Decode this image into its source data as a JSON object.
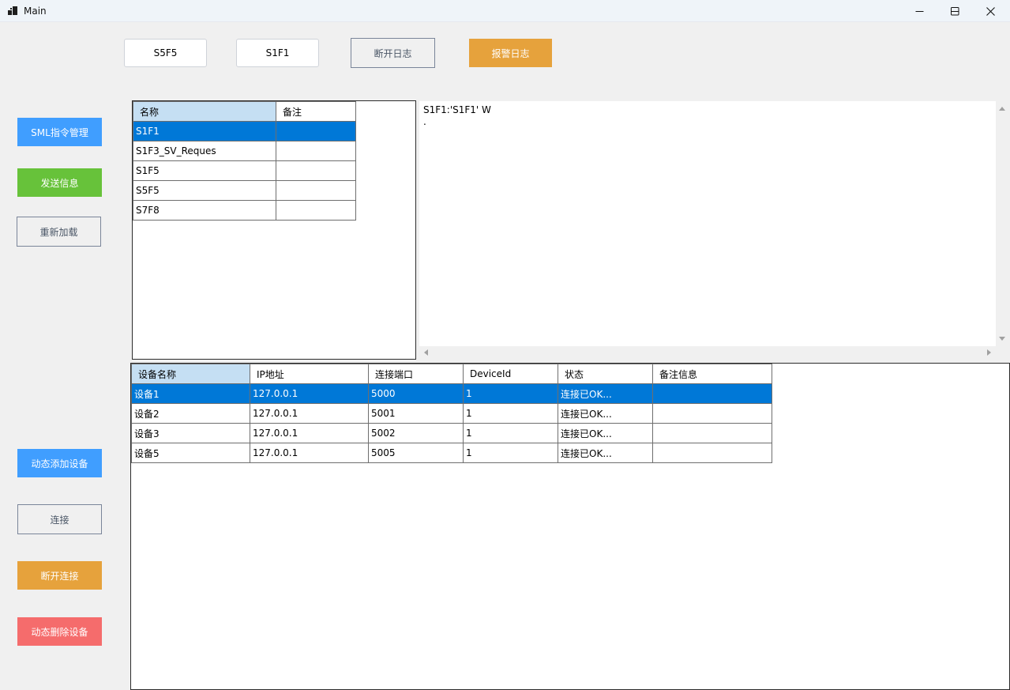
{
  "window": {
    "title": "Main",
    "controls": {
      "minimize_icon": "minimize-icon",
      "maximize_icon": "maximize-icon",
      "close_icon": "close-icon"
    }
  },
  "top_toolbar": {
    "s5f5_label": "S5F5",
    "s1f1_label": "S1F1",
    "disconnect_log_label": "断开日志",
    "alarm_log_label": "报警日志"
  },
  "left_panel": {
    "sml_manage_label": "SML指令管理",
    "send_message_label": "发送信息",
    "reload_label": "重新加载",
    "add_device_label": "动态添加设备",
    "connect_label": "连接",
    "disconnect_label": "断开连接",
    "delete_device_label": "动态删除设备"
  },
  "command_table": {
    "columns": [
      "名称",
      "备注"
    ],
    "rows": [
      {
        "name": "S1F1",
        "note": "",
        "selected": true
      },
      {
        "name": "S1F3_SV_Reques",
        "note": "",
        "selected": false
      },
      {
        "name": "S1F5",
        "note": "",
        "selected": false
      },
      {
        "name": "S5F5",
        "note": "",
        "selected": false
      },
      {
        "name": "S7F8",
        "note": "",
        "selected": false
      }
    ]
  },
  "message_log": {
    "lines": [
      "S1F1:'S1F1' W",
      "."
    ]
  },
  "device_table": {
    "columns": [
      "设备名称",
      "IP地址",
      "连接端口",
      "DeviceId",
      "状态",
      "备注信息"
    ],
    "rows": [
      {
        "name": "设备1",
        "ip": "127.0.0.1",
        "port": "5000",
        "device_id": "1",
        "status": "连接已OK...",
        "note": "",
        "selected": true
      },
      {
        "name": "设备2",
        "ip": "127.0.0.1",
        "port": "5001",
        "device_id": "1",
        "status": "连接已OK...",
        "note": "",
        "selected": false
      },
      {
        "name": "设备3",
        "ip": "127.0.0.1",
        "port": "5002",
        "device_id": "1",
        "status": "连接已OK...",
        "note": "",
        "selected": false
      },
      {
        "name": "设备5",
        "ip": "127.0.0.1",
        "port": "5005",
        "device_id": "1",
        "status": "连接已OK...",
        "note": "",
        "selected": false
      }
    ]
  },
  "colors": {
    "selection": "#0078d7",
    "header_highlight": "#c5dff3",
    "primary": "#409eff",
    "success": "#67c23a",
    "warning": "#e6a23c",
    "danger": "#f56c6c"
  }
}
